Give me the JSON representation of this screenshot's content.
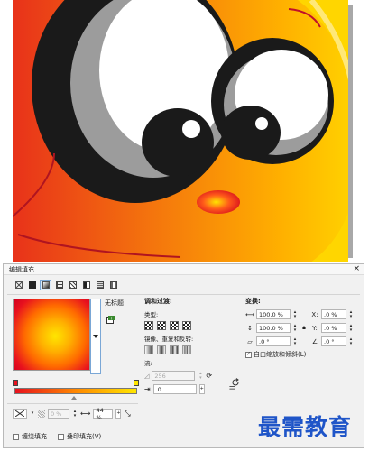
{
  "dialog": {
    "title": "编辑填充",
    "close_glyph": "×"
  },
  "toolbar": {
    "buttons": [
      "no-fill",
      "uniform-fill",
      "fountain-fill",
      "vector-pattern-fill",
      "bitmap-pattern-fill",
      "two-color-pattern-fill",
      "texture-fill",
      "postscript-fill"
    ],
    "active_index": 2
  },
  "preview": {
    "name_label": "无标题"
  },
  "gradient": {
    "start_color": "#e8121e",
    "end_color": "#ffe600"
  },
  "bottom": {
    "transparency_value": "0 %",
    "position_value": "44 %"
  },
  "blend": {
    "title": "调和过渡:",
    "type_label": "类型:",
    "mirror_label": "镜像、重复和反转:",
    "steps_label": "流:",
    "steps_value": "256",
    "accel_value": ".0"
  },
  "transform": {
    "title": "变换:",
    "width": "100.0 %",
    "height": "100.0 %",
    "x": ".0 %",
    "y": ".0 %",
    "skew": ".0 °",
    "rotate": ".0 °",
    "free_scale_label": "自由缩放和倾斜(L)"
  },
  "footer": {
    "wrap_label": "缠绕填充",
    "overprint_label": "叠印填充(V)"
  },
  "watermark": "最需教育",
  "colors": {
    "accent": "#7aa7d6",
    "watermark": "#1f55c8"
  }
}
